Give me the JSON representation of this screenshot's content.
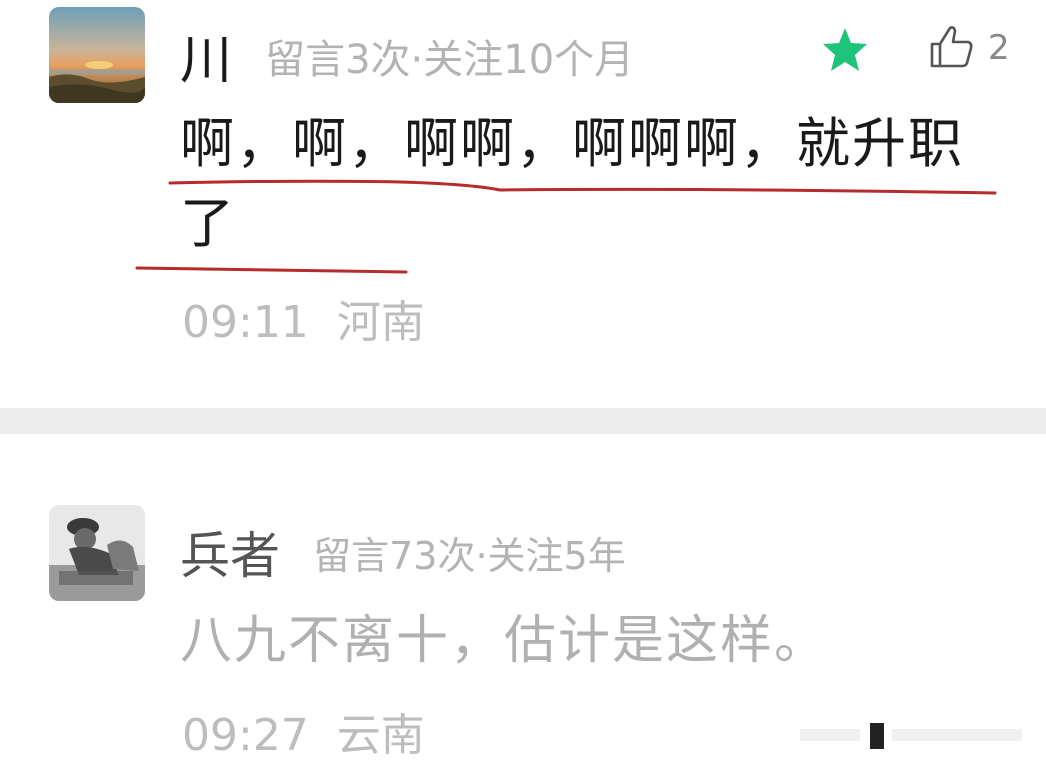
{
  "comments": [
    {
      "username": "川",
      "meta": "留言3次·关注10个月",
      "content": "啊，啊，啊啊，啊啊啊，就升职了",
      "time": "09:11",
      "location": "河南",
      "like_count": "2",
      "starred": true,
      "star_color": "#1ec47a"
    },
    {
      "username": "兵者",
      "meta": "留言73次·关注5年",
      "content": "八九不离十，估计是这样。",
      "time": "09:27",
      "location": "云南"
    }
  ],
  "annotation_color": "#b52c2c"
}
